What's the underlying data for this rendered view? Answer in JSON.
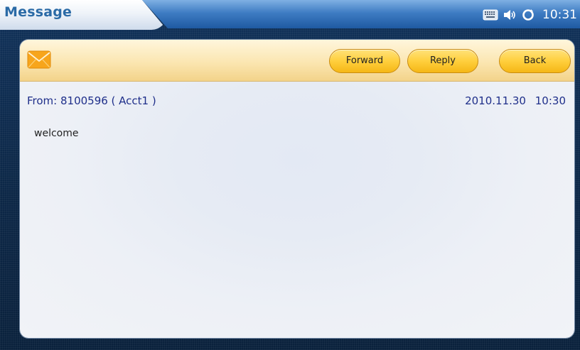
{
  "header": {
    "title": "Message",
    "status_icons": [
      "keyboard-icon",
      "volume-icon",
      "sync-icon"
    ],
    "time": "10:31"
  },
  "toolbar": {
    "icon": "envelope-icon",
    "forward_label": "Forward",
    "reply_label": "Reply",
    "back_label": "Back"
  },
  "message": {
    "from": "From:  8100596 ( Acct1 )",
    "date": "2010.11.30",
    "time": "10:30",
    "body": "welcome"
  },
  "colors": {
    "title_text": "#2a6aa6",
    "accent_button": "#ffcf3d",
    "meta_text": "#1f2f8a"
  }
}
